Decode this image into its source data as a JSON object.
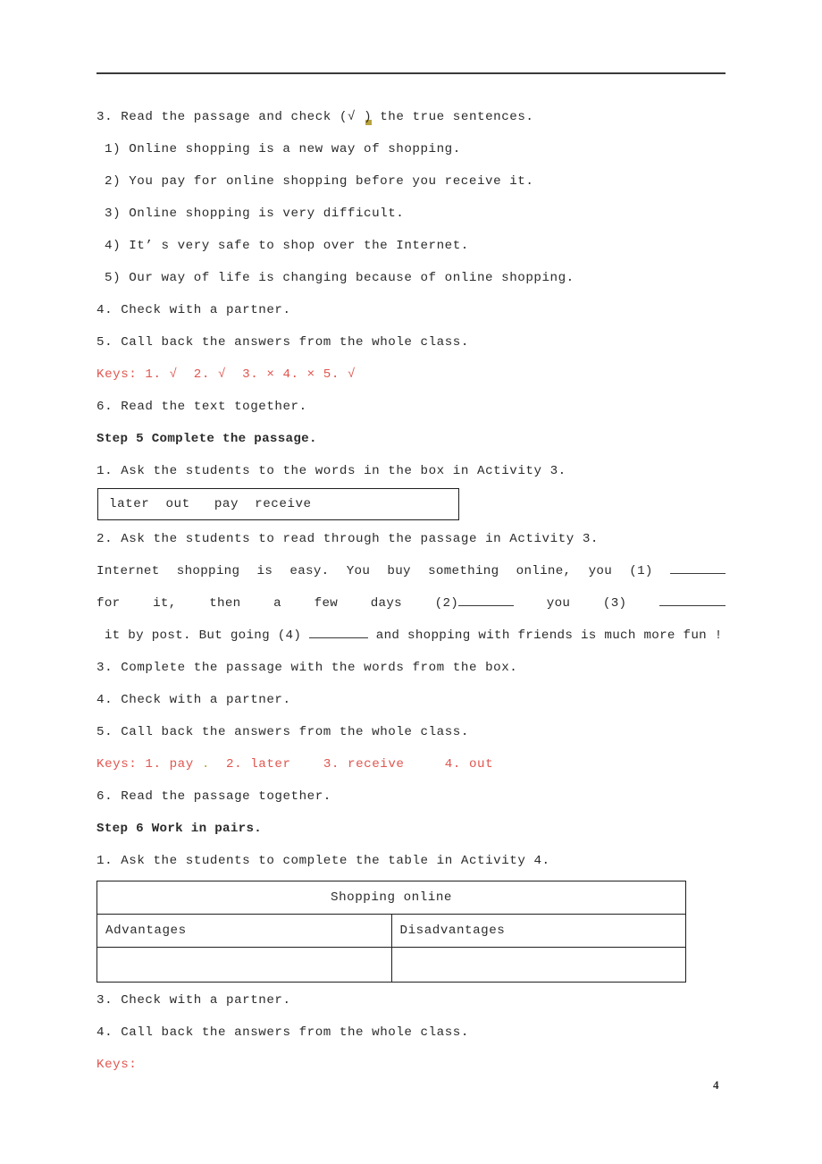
{
  "document": {
    "page_number": "4",
    "keys_color": "#e0564f",
    "text_color": "#2b2b2b"
  },
  "section_activity3": {
    "instruction": "3. Read the passage and check (√ ) the true sentences.",
    "sentences": [
      "1) Online shopping is a new way of shopping.",
      "2) You pay for online shopping before you receive it.",
      "3) Online shopping is very difficult.",
      "4) It’ s very safe to shop over the Internet.",
      "5) Our way of life is changing because of online shopping."
    ],
    "step_4": "4. Check with a partner.",
    "step_5": "5. Call back the answers from the whole class.",
    "keys": "Keys: 1. √  2. √  3. × 4. × 5. √",
    "step_6": "6. Read the text together."
  },
  "step5": {
    "heading": "Step 5 Complete the passage.",
    "item_1": "1. Ask the students to the words in the box in Activity 3.",
    "word_bank": "later  out   pay  receive",
    "item_2": "2. Ask the students to read through the passage in Activity 3.",
    "passage": {
      "part_a": "Internet shopping is easy. You buy something online, you (1) ",
      "part_b": "for it, then a few days (2)",
      "part_c": " you (3) ",
      "part_d": " it by post. But going (4) ",
      "part_e": " and shopping with friends is much more fun !"
    },
    "item_3": "3. Complete the passage with the words from the box.",
    "item_4": "4. Check with a partner.",
    "item_5": "5. Call back the answers from the whole class.",
    "keys_prefix": "Keys: 1. pay ",
    "keys_dot": ".",
    "keys_suffix": "  2. later    3. receive     4. out",
    "item_6": "6. Read the passage together."
  },
  "step6": {
    "heading": "Step 6 Work in pairs.",
    "item_1": "1. Ask the students to complete the table in Activity 4.",
    "table": {
      "title": "Shopping online",
      "columns": [
        "Advantages",
        "Disadvantages"
      ],
      "empty_row": [
        "",
        ""
      ]
    },
    "item_3": "3. Check with a partner.",
    "item_4": "4. Call back the answers from the whole class.",
    "keys": "Keys:"
  }
}
